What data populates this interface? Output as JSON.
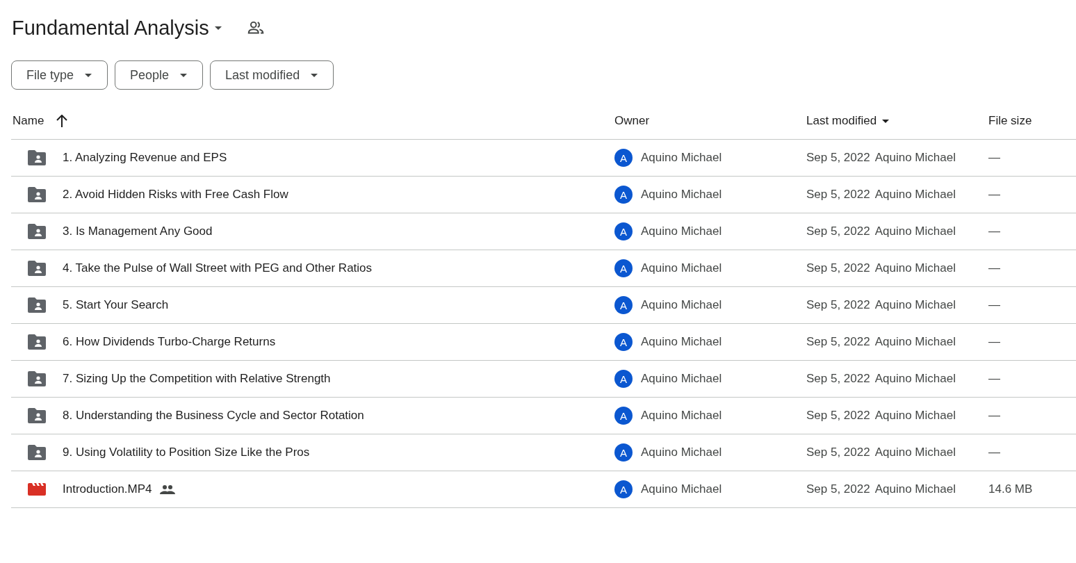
{
  "title": "Fundamental Analysis",
  "filters": [
    "File type",
    "People",
    "Last modified"
  ],
  "columns": [
    {
      "label": "Name",
      "kind": "sort-arrow"
    },
    {
      "label": "Owner",
      "kind": "plain"
    },
    {
      "label": "Last modified",
      "kind": "dropdown"
    },
    {
      "label": "File size",
      "kind": "plain"
    }
  ],
  "rows": [
    {
      "kind": "folder",
      "name": "1. Analyzing Revenue and EPS",
      "shared": false,
      "owner_initial": "A",
      "owner": "Aquino Michael",
      "modified": "Sep 5, 2022",
      "modified_by": "Aquino Michael",
      "size": "—"
    },
    {
      "kind": "folder",
      "name": "2. Avoid Hidden Risks with Free Cash Flow",
      "shared": false,
      "owner_initial": "A",
      "owner": "Aquino Michael",
      "modified": "Sep 5, 2022",
      "modified_by": "Aquino Michael",
      "size": "—"
    },
    {
      "kind": "folder",
      "name": "3. Is Management Any Good",
      "shared": false,
      "owner_initial": "A",
      "owner": "Aquino Michael",
      "modified": "Sep 5, 2022",
      "modified_by": "Aquino Michael",
      "size": "—"
    },
    {
      "kind": "folder",
      "name": "4. Take the Pulse of Wall Street with PEG and Other Ratios",
      "shared": false,
      "owner_initial": "A",
      "owner": "Aquino Michael",
      "modified": "Sep 5, 2022",
      "modified_by": "Aquino Michael",
      "size": "—"
    },
    {
      "kind": "folder",
      "name": "5. Start Your Search",
      "shared": false,
      "owner_initial": "A",
      "owner": "Aquino Michael",
      "modified": "Sep 5, 2022",
      "modified_by": "Aquino Michael",
      "size": "—"
    },
    {
      "kind": "folder",
      "name": "6. How Dividends Turbo-Charge Returns",
      "shared": false,
      "owner_initial": "A",
      "owner": "Aquino Michael",
      "modified": "Sep 5, 2022",
      "modified_by": "Aquino Michael",
      "size": "—"
    },
    {
      "kind": "folder",
      "name": "7. Sizing Up the Competition with Relative Strength",
      "shared": false,
      "owner_initial": "A",
      "owner": "Aquino Michael",
      "modified": "Sep 5, 2022",
      "modified_by": "Aquino Michael",
      "size": "—"
    },
    {
      "kind": "folder",
      "name": "8. Understanding the Business Cycle and Sector Rotation",
      "shared": false,
      "owner_initial": "A",
      "owner": "Aquino Michael",
      "modified": "Sep 5, 2022",
      "modified_by": "Aquino Michael",
      "size": "—"
    },
    {
      "kind": "folder",
      "name": "9. Using Volatility to Position Size Like the Pros",
      "shared": false,
      "owner_initial": "A",
      "owner": "Aquino Michael",
      "modified": "Sep 5, 2022",
      "modified_by": "Aquino Michael",
      "size": "—"
    },
    {
      "kind": "video",
      "name": "Introduction.MP4",
      "shared": true,
      "owner_initial": "A",
      "owner": "Aquino Michael",
      "modified": "Sep 5, 2022",
      "modified_by": "Aquino Michael",
      "size": "14.6 MB"
    }
  ]
}
